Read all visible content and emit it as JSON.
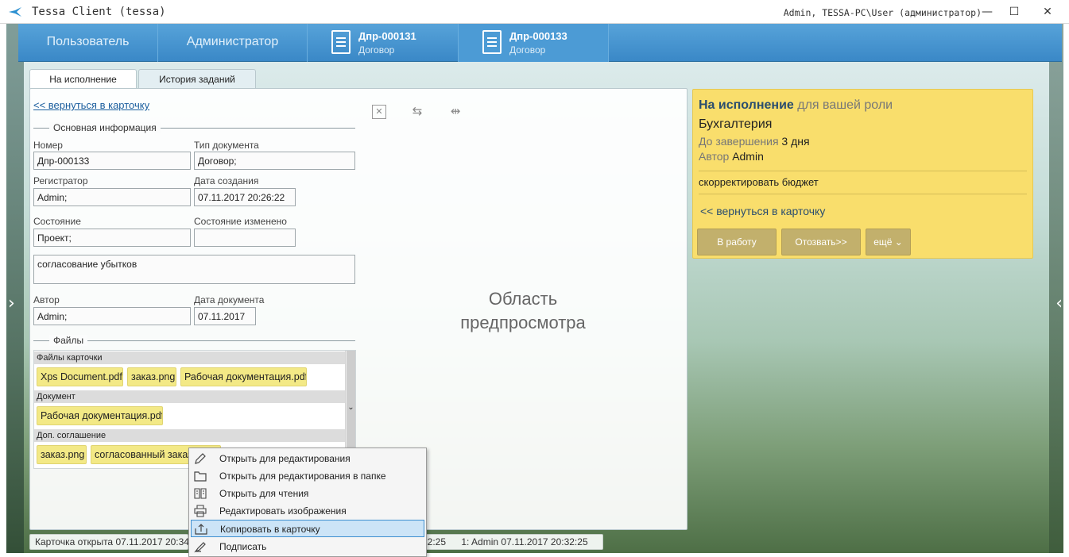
{
  "window": {
    "title": "Tessa Client (tessa)",
    "user": "Admin, TESSA-PC\\User (администратор)",
    "minimize": "—",
    "maximize": "☐",
    "close": "✕"
  },
  "nav": {
    "user": "Пользователь",
    "admin": "Администратор",
    "tabs": [
      {
        "title": "Дпр-000131",
        "subtitle": "Договор"
      },
      {
        "title": "Дпр-000133",
        "subtitle": "Договор"
      }
    ],
    "left_arrow": "‹",
    "right_arrow": "‹"
  },
  "tabs": {
    "execution": "На исполнение",
    "history": "История заданий"
  },
  "card": {
    "back_link": "<< вернуться в карточку",
    "section_main": "Основная информация",
    "number_label": "Номер",
    "number": "Дпр-000133",
    "doctype_label": "Тип документа",
    "doctype": "Договор;",
    "registrar_label": "Регистратор",
    "registrar": "Admin;",
    "created_label": "Дата создания",
    "created": "07.11.2017  20:26:22",
    "state_label": "Состояние",
    "state": "Проект;",
    "state_changed_label": "Состояние изменено",
    "state_changed": "",
    "comment": "согласование убытков",
    "author_label": "Автор",
    "author": "Admin;",
    "docdate_label": "Дата документа",
    "docdate": "07.11.2017",
    "section_files": "Файлы",
    "file_groups": [
      {
        "name": "Файлы карточки",
        "files": [
          "Xps Document.pdf",
          "заказ.png",
          "Рабочая документация.pdf"
        ]
      },
      {
        "name": "Документ",
        "files": [
          "Рабочая документация.pdf"
        ]
      },
      {
        "name": "Доп. соглашение",
        "files": [
          "заказ.png",
          "согласованный заказ.png"
        ]
      }
    ],
    "scroll_chevron": "⌄"
  },
  "preview": {
    "close_icon": "✕",
    "swap_icon": "⇆",
    "split_icon": "⇹",
    "text_line1": "Область",
    "text_line2": "предпросмотра"
  },
  "task": {
    "status": "На исполнение",
    "status_role": "для вашей роли",
    "role": "Бухгалтерия",
    "due_label": "До завершения",
    "due_value": "3 дня",
    "author_label": "Автор",
    "author_value": "Admin",
    "description": "скорректировать бюджет",
    "back_link": "<< вернуться в карточку",
    "btn_work": "В работу",
    "btn_revoke": "Отозвать>>",
    "btn_more": "ещё ⌄"
  },
  "status": {
    "opened": "Карточка открыта 07.11.2017 20:34",
    "version_time": "32:25",
    "version": "1:  Admin  07.11.2017 20:32:25"
  },
  "context_menu": {
    "items": [
      {
        "label": "Открыть для редактирования",
        "icon": "pencil-icon"
      },
      {
        "label": "Открыть для редактирования в папке",
        "icon": "folder-icon"
      },
      {
        "label": "Открыть для чтения",
        "icon": "book-icon"
      },
      {
        "label": "Редактировать изображения",
        "icon": "printer-icon"
      },
      {
        "label": "Копировать в карточку",
        "icon": "upload-icon"
      },
      {
        "label": "Подписать",
        "icon": "signature-icon"
      }
    ],
    "highlighted_index": 4
  },
  "colors": {
    "nav_blue": "#3a88c7",
    "task_yellow": "#f9de6c",
    "file_tag": "#f3e986",
    "link_blue": "#1b5e9e",
    "menu_highlight": "#cce4f7"
  }
}
